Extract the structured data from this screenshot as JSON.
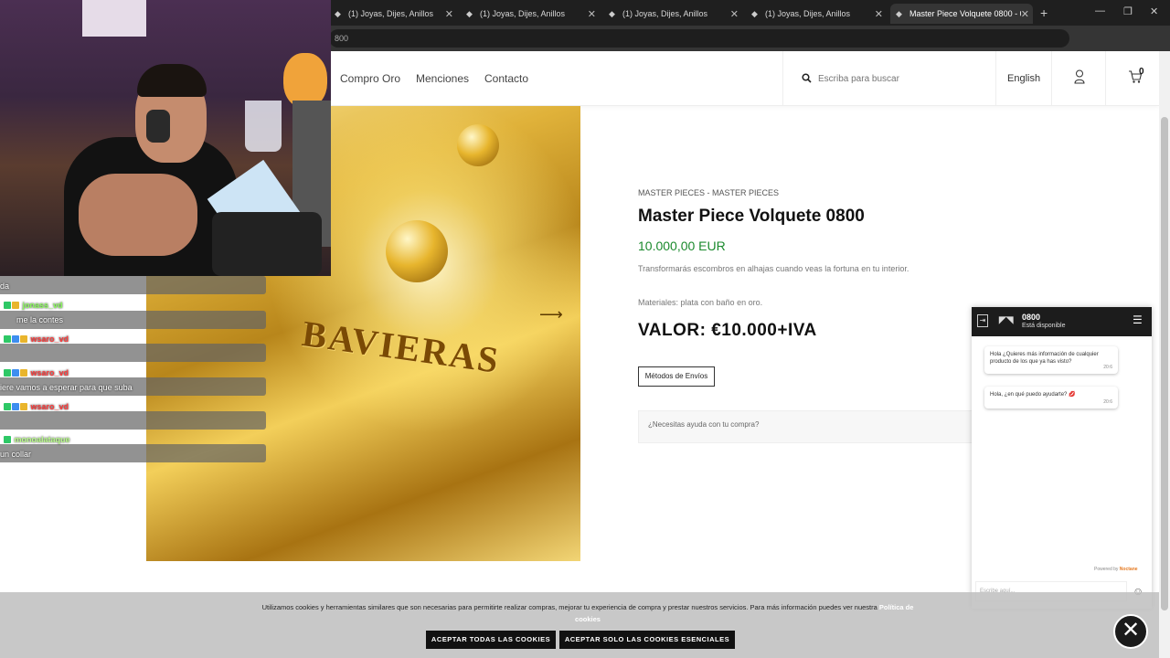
{
  "browser": {
    "tabs": [
      {
        "title": "(1) Joyas, Dijes, Anillos"
      },
      {
        "title": "(1) Joyas, Dijes, Anillos"
      },
      {
        "title": "(1) Joyas, Dijes, Anillos"
      },
      {
        "title": "(1) Joyas, Dijes, Anillos"
      },
      {
        "title": "Master Piece Volquete 0800 - 0"
      }
    ],
    "new_tab": "+",
    "url": "800"
  },
  "header": {
    "nav": [
      "Compro Oro",
      "Menciones",
      "Contacto"
    ],
    "search_placeholder": "Escriba para buscar",
    "language": "English",
    "cart_count": "0"
  },
  "product": {
    "image_text": "BAVIERAS",
    "breadcrumb": "MASTER PIECES - MASTER PIECES",
    "title": "Master Piece Volquete 0800",
    "price": "10.000,00 EUR",
    "description": "Transformarás escombros en alhajas cuando veas la fortuna en tu interior.",
    "materials": "Materiales: plata con baño en oro.",
    "valor": "VALOR: €10.000+IVA",
    "shipping_button": "Métodos de Envíos",
    "help_prompt": "¿Necesitas ayuda con tu compra?"
  },
  "chat_widget": {
    "name": "0800",
    "status": "Está disponible",
    "messages": [
      {
        "text": "Hola ¿Quieres más información de cualquier producto de los que ya has visto?",
        "time": "20:6"
      },
      {
        "text": "Hola, ¿en qué puedo ayudarte? 💋",
        "time": "20:6"
      }
    ],
    "powered_prefix": "Powered by",
    "powered_brand": "Noctane",
    "input_placeholder": "Escribe aquí..."
  },
  "cookie_banner": {
    "text": "Utilizamos cookies y herramientas similares que son necesarias para permitirte realizar compras, mejorar tu experiencia de compra y prestar nuestros servicios. Para más información puedes ver nuestra",
    "link": "Política de cookies",
    "accept_all": "ACEPTAR TODAS LAS COOKIES",
    "accept_essential": "ACEPTAR SOLO LAS COOKIES ESENCIALES"
  },
  "stream_chat": [
    {
      "user": "",
      "message": "da"
    },
    {
      "user": "jonass_vd",
      "message": ""
    },
    {
      "user": "",
      "message": "me la contes"
    },
    {
      "user": "wsaro_vd",
      "message": ""
    },
    {
      "user": "wsaro_vd",
      "message": ""
    },
    {
      "user": "",
      "message": "iere vamos a esperar para que     suba"
    },
    {
      "user": "wsaro_vd",
      "message": ""
    },
    {
      "user": "monoalataque",
      "message": ""
    },
    {
      "user": "",
      "message": "un collar"
    }
  ],
  "colors": {
    "price_green": "#1b8a2d",
    "chrome_dark": "#1f1f1f",
    "cookie_bg": "#bebebe",
    "button_black": "#111111"
  }
}
